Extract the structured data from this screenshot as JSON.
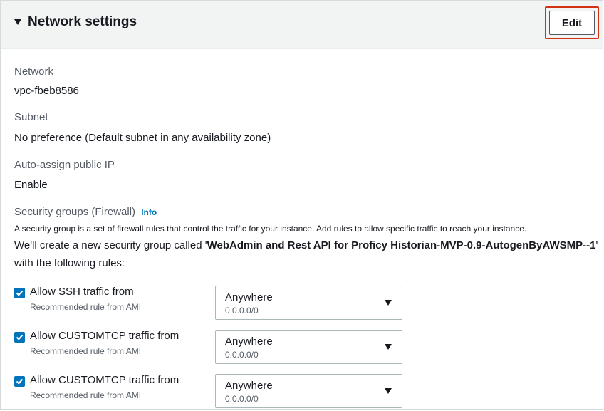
{
  "header": {
    "title": "Network settings",
    "edit_label": "Edit"
  },
  "fields": {
    "network_label": "Network",
    "network_value": "vpc-fbeb8586",
    "subnet_label": "Subnet",
    "subnet_value": "No preference (Default subnet in any availability zone)",
    "public_ip_label": "Auto-assign public IP",
    "public_ip_value": "Enable"
  },
  "security_groups": {
    "label": "Security groups (Firewall)",
    "info_link": "Info",
    "description": "A security group is a set of firewall rules that control the traffic for your instance. Add rules to allow specific traffic to reach your instance.",
    "create_prefix": "We'll create a new security group called '",
    "group_name": "WebAdmin and Rest API for Proficy Historian-MVP-0.9-AutogenByAWSMP--1",
    "create_suffix": "' with the following rules:",
    "rules": [
      {
        "title": "Allow SSH traffic from",
        "subtitle": "Recommended rule from AMI",
        "checked": true,
        "source": "Anywhere",
        "cidr": "0.0.0.0/0"
      },
      {
        "title": "Allow CUSTOMTCP traffic from",
        "subtitle": "Recommended rule from AMI",
        "checked": true,
        "source": "Anywhere",
        "cidr": "0.0.0.0/0"
      },
      {
        "title": "Allow CUSTOMTCP traffic from",
        "subtitle": "Recommended rule from AMI",
        "checked": true,
        "source": "Anywhere",
        "cidr": "0.0.0.0/0"
      }
    ]
  },
  "colors": {
    "header_bg": "#f2f3f3",
    "highlight": "#d13212",
    "checkbox": "#0073bb",
    "link": "#0073bb"
  }
}
